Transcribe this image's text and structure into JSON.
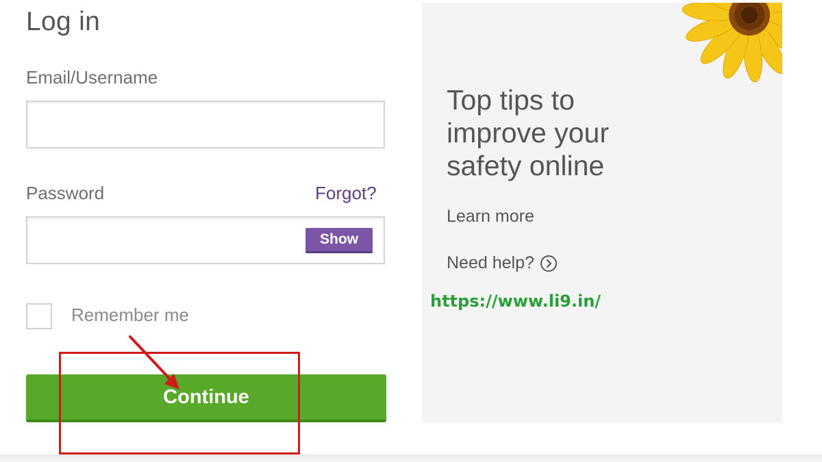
{
  "login": {
    "title": "Log in",
    "email_label": "Email/Username",
    "email_value": "",
    "password_label": "Password",
    "password_value": "",
    "forgot_link": "Forgot?",
    "show_button": "Show",
    "remember_label": "Remember me",
    "remember_checked": false,
    "continue_button": "Continue"
  },
  "promo": {
    "headline": "Top tips to improve your safety online",
    "learn_more": "Learn more",
    "need_help": "Need help?",
    "image_icon": "sunflower-image"
  },
  "watermark": {
    "url": "https://www.li9.in/"
  },
  "annotation": {
    "highlight_color": "#d01b1b"
  },
  "colors": {
    "accent_purple": "#7b55a6",
    "forgot_purple": "#5c3e85",
    "continue_green": "#58a82a",
    "watermark_green": "#2aa039",
    "panel_bg": "#f4f4f5"
  }
}
